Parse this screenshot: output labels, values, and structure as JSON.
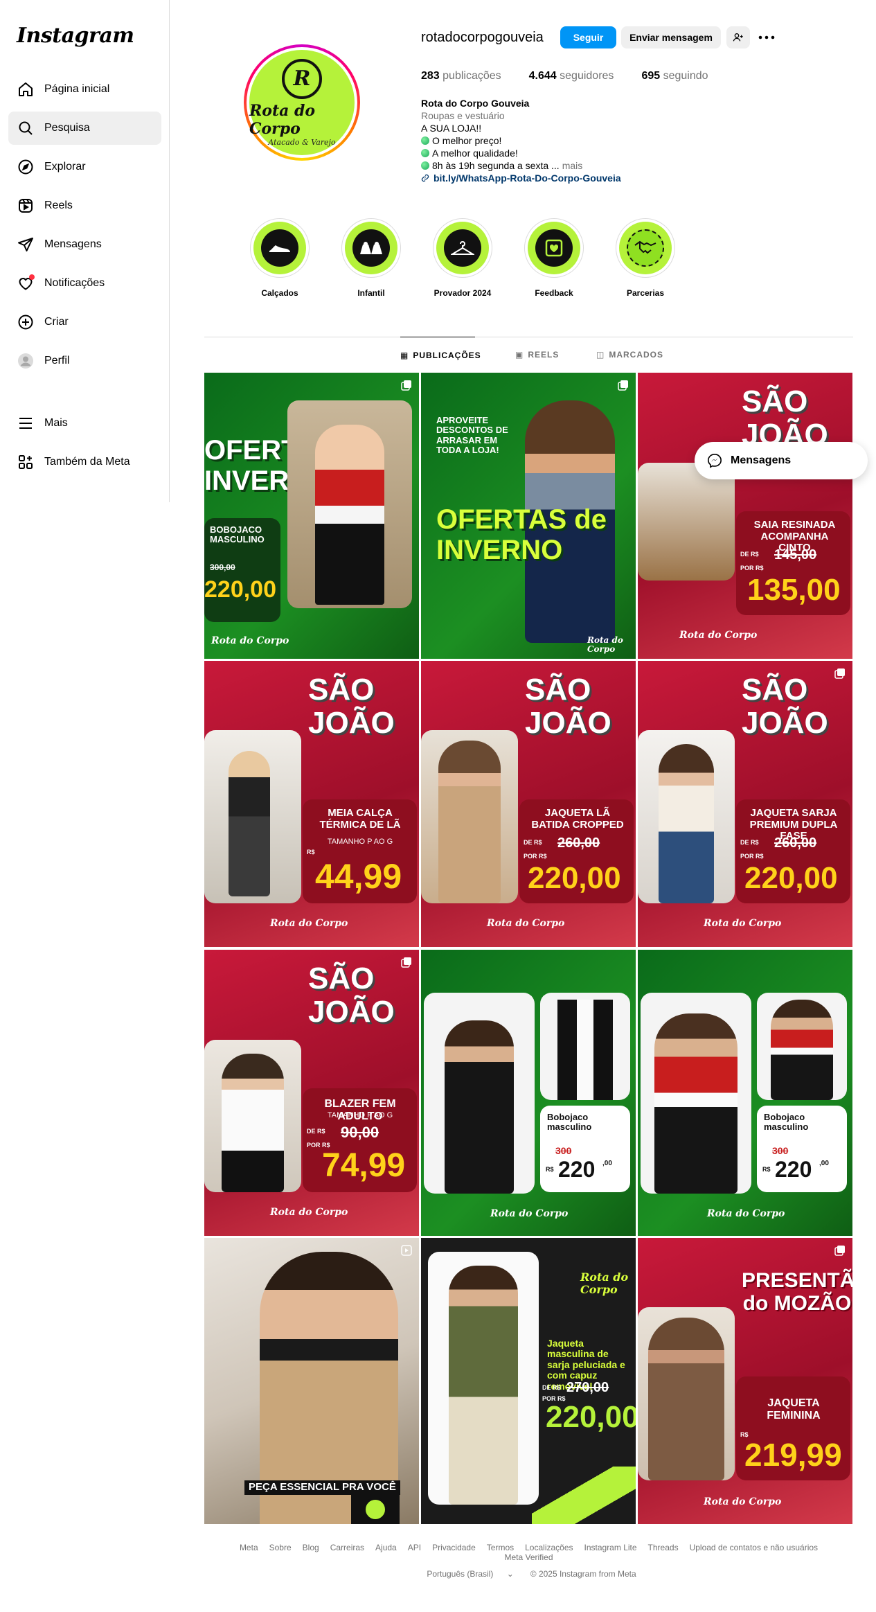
{
  "app": {
    "logo": "Instagram"
  },
  "sidebar": {
    "items": [
      {
        "label": "Página inicial",
        "icon": "home-icon"
      },
      {
        "label": "Pesquisa",
        "icon": "search-icon",
        "active": true
      },
      {
        "label": "Explorar",
        "icon": "compass-icon"
      },
      {
        "label": "Reels",
        "icon": "reels-icon"
      },
      {
        "label": "Mensagens",
        "icon": "direct-icon"
      },
      {
        "label": "Notificações",
        "icon": "heart-icon"
      },
      {
        "label": "Criar",
        "icon": "plus-square-icon"
      },
      {
        "label": "Perfil",
        "icon": "avatar-icon"
      }
    ],
    "bottom_items": [
      {
        "label": "Mais",
        "icon": "menu-icon"
      },
      {
        "label": "Também da Meta",
        "icon": "meta-apps-icon"
      }
    ]
  },
  "profile": {
    "username": "rotadocorpogouveia",
    "follow_label": "Seguir",
    "message_label": "Enviar mensagem",
    "stats": {
      "posts_count": "283",
      "posts_label": "publicações",
      "followers_count": "4.644",
      "followers_label": "seguidores",
      "following_count": "695",
      "following_label": "seguindo"
    },
    "bio": {
      "name": "Rota do Corpo Gouveia",
      "category": "Roupas e vestuário",
      "line1": "A SUA LOJA!!",
      "line2": "O melhor preço!",
      "line3": "A melhor qualidade!",
      "line4": "8h às 19h segunda a sexta ...",
      "more": "mais",
      "link": "bit.ly/WhatsApp-Rota-Do-Corpo-Gouveia"
    },
    "avatar": {
      "monogram": "R",
      "brand": "Rota do Corpo",
      "sub": "Atacado & Varejo"
    }
  },
  "highlights": [
    {
      "label": "Calçados",
      "icon": "shoe-icon"
    },
    {
      "label": "Infantil",
      "icon": "kids-clothes-icon"
    },
    {
      "label": "Provador 2024",
      "icon": "hanger-icon"
    },
    {
      "label": "Feedback",
      "icon": "feedback-heart-icon"
    },
    {
      "label": "Parcerias",
      "icon": "handshake-icon"
    }
  ],
  "tabs": [
    {
      "label": "PUBLICAÇÕES",
      "icon": "grid-icon",
      "active": true
    },
    {
      "label": "REELS",
      "icon": "reels-icon"
    },
    {
      "label": "MARCADOS",
      "icon": "tagged-icon"
    }
  ],
  "posts": [
    {
      "title": "OFERTAS de INVERNO",
      "product": "BOBOJACO MASCULINO",
      "old_price": "300,00",
      "price": "220,00",
      "brand": "Rota do Corpo"
    },
    {
      "title": "OFERTAS de INVERNO",
      "tagline": "APROVEITE DESCONTOS DE ARRASAR EM TODA A LOJA!",
      "brand": "Rota do Corpo"
    },
    {
      "title": "SÃO JOÃO",
      "product": "SAIA RESINADA ACOMPANHA CINTO",
      "de_label": "DE R$",
      "old_price": "145,00",
      "por_label": "POR R$",
      "price": "135,00",
      "brand": "Rota do Corpo"
    },
    {
      "title": "SÃO JOÃO",
      "product": "MEIA CALÇA TÉRMICA DE LÃ",
      "size": "TAMANHO P AO G",
      "currency": "R$",
      "price": "44,99",
      "brand": "Rota do Corpo"
    },
    {
      "title": "SÃO JOÃO",
      "product": "JAQUETA LÃ BATIDA CROPPED",
      "de_label": "DE R$",
      "old_price": "260,00",
      "por_label": "POR R$",
      "price": "220,00",
      "brand": "Rota do Corpo"
    },
    {
      "title": "SÃO JOÃO",
      "product": "JAQUETA SARJA PREMIUM DUPLA FASE",
      "de_label": "DE R$",
      "old_price": "260,00",
      "por_label": "POR R$",
      "price": "220,00",
      "brand": "Rota do Corpo"
    },
    {
      "title": "SÃO JOÃO",
      "product": "BLAZER FEM ADULTO",
      "size": "TAMANHO P AO G",
      "de_label": "DE R$",
      "old_price": "90,00",
      "por_label": "POR R$",
      "price": "74,99",
      "brand": "Rota do Corpo"
    },
    {
      "product": "Bobojaco masculino",
      "old_price": "300",
      "currency": "R$",
      "price": "220",
      "cents": ",00",
      "brand": "Rota do Corpo"
    },
    {
      "product": "Bobojaco masculino",
      "old_price": "300",
      "currency": "R$",
      "price": "220",
      "cents": ",00",
      "brand": "Rota do Corpo"
    },
    {
      "caption": "PEÇA ESSENCIAL PRA VOCÊ"
    },
    {
      "product": "Jaqueta masculina de sarja peluciada e com capuz removível",
      "de_label": "DE R$",
      "old_price": "270,00",
      "por_label": "POR R$",
      "price": "220,00",
      "brand": "Rota do Corpo"
    },
    {
      "title": "PRESENTÃO do MOZÃO",
      "product": "JAQUETA FEMININA",
      "currency": "R$",
      "price": "219,99",
      "brand": "Rota do Corpo"
    }
  ],
  "floating": {
    "messages_label": "Mensagens"
  },
  "footer": {
    "links": [
      "Meta",
      "Sobre",
      "Blog",
      "Carreiras",
      "Ajuda",
      "API",
      "Privacidade",
      "Termos",
      "Localizações",
      "Instagram Lite",
      "Threads",
      "Upload de contatos e não usuários",
      "Meta Verified"
    ],
    "language": "Português (Brasil)",
    "copyright": "© 2025 Instagram from Meta"
  },
  "colors": {
    "accent": "#0095f6",
    "brand_green": "#b5f23a",
    "sale_red": "#9e0f2a",
    "price_yellow": "#ffd21a"
  }
}
